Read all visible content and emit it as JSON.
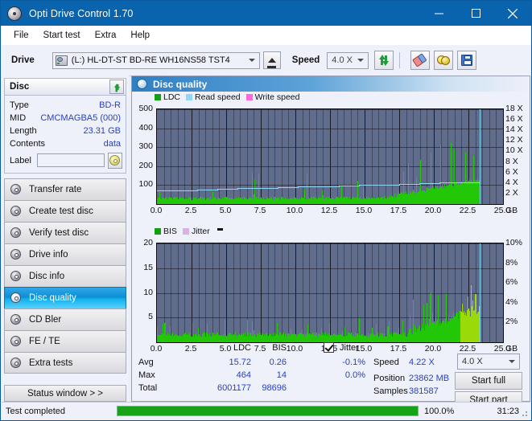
{
  "window": {
    "title": "Opti Drive Control 1.70",
    "app_icon": "disc-icon",
    "minimize": "minimize-icon",
    "maximize": "maximize-icon",
    "close": "close-icon"
  },
  "menu": [
    {
      "label": "File"
    },
    {
      "label": "Start test"
    },
    {
      "label": "Extra"
    },
    {
      "label": "Help"
    }
  ],
  "toolbar": {
    "drive_label": "Drive",
    "drive_value": "(L:)  HL-DT-ST BD-RE  WH16NS58 TST4",
    "eject_icon": "eject-icon",
    "speed_label": "Speed",
    "speed_value": "4.0 X",
    "refresh_icon": "refresh-icon",
    "erase_icon": "eraser-icon",
    "coin_icon": "coins-icon",
    "save_icon": "save-icon"
  },
  "disc_panel": {
    "title": "Disc",
    "refresh_icon": "refresh-icon",
    "rows": [
      {
        "key": "Type",
        "value": "BD-R"
      },
      {
        "key": "MID",
        "value": "CMCMAGBA5 (000)"
      },
      {
        "key": "Length",
        "value": "23.31 GB"
      },
      {
        "key": "Contents",
        "value": "data"
      }
    ],
    "label_key": "Label",
    "label_value": "",
    "label_placeholder": "",
    "label_button_icon": "cd-icon"
  },
  "sidebar": {
    "items": [
      {
        "label": "Transfer rate",
        "icon": "disc-icon",
        "active": false
      },
      {
        "label": "Create test disc",
        "icon": "disc-icon",
        "active": false
      },
      {
        "label": "Verify test disc",
        "icon": "disc-icon",
        "active": false
      },
      {
        "label": "Drive info",
        "icon": "disc-icon",
        "active": false
      },
      {
        "label": "Disc info",
        "icon": "disc-icon",
        "active": false
      },
      {
        "label": "Disc quality",
        "icon": "disc-icon",
        "active": true
      },
      {
        "label": "CD Bler",
        "icon": "disc-icon",
        "active": false
      },
      {
        "label": "FE / TE",
        "icon": "disc-icon",
        "active": false
      },
      {
        "label": "Extra tests",
        "icon": "disc-icon",
        "active": false
      }
    ],
    "status_window": "Status window > >"
  },
  "content": {
    "header_title": "Disc quality",
    "header_icon": "disc-icon"
  },
  "chart_data": [
    {
      "type": "line",
      "name": "ldc-chart",
      "title": "",
      "xlabel": "GB",
      "ylabel": "",
      "x_ticks": [
        "0.0",
        "2.5",
        "5.0",
        "7.5",
        "10.0",
        "12.5",
        "15.0",
        "17.5",
        "20.0",
        "22.5",
        "25.0"
      ],
      "xlim": [
        0.0,
        25.0
      ],
      "y_left_ticks": [
        "100",
        "200",
        "300",
        "400",
        "500"
      ],
      "ylim": [
        0,
        500
      ],
      "y_right_ticks": [
        "2 X",
        "4 X",
        "6 X",
        "8 X",
        "10 X",
        "12 X",
        "14 X",
        "16 X",
        "18 X"
      ],
      "ylim_right": [
        0,
        18
      ],
      "x_unit": "GB",
      "legend": [
        {
          "label": "LDC",
          "color": "#12a012"
        },
        {
          "label": "Read speed",
          "color": "#8fd8f5"
        },
        {
          "label": "Write speed",
          "color": "#ff66dd"
        }
      ],
      "legend_position": "top-left",
      "grid": true,
      "series": [
        {
          "name": "LDC",
          "color": "#22c808",
          "kind": "bar",
          "max_value": 464,
          "avg_value": 15.72
        },
        {
          "name": "Read speed",
          "color": "#8fd8f5",
          "kind": "line",
          "start_x": 0.0,
          "end_x": 23.3,
          "start_value": 2.6,
          "end_value": 4.3
        }
      ],
      "data_end_x": 23.31
    },
    {
      "type": "line",
      "name": "bis-chart",
      "title": "",
      "xlabel": "GB",
      "ylabel": "",
      "x_ticks": [
        "0.0",
        "2.5",
        "5.0",
        "7.5",
        "10.0",
        "12.5",
        "15.0",
        "17.5",
        "20.0",
        "22.5",
        "25.0"
      ],
      "xlim": [
        0.0,
        25.0
      ],
      "y_left_ticks": [
        "5",
        "10",
        "15",
        "20"
      ],
      "ylim": [
        0,
        20
      ],
      "y_right_ticks": [
        "2%",
        "4%",
        "6%",
        "8%",
        "10%"
      ],
      "ylim_right": [
        0,
        10
      ],
      "x_unit": "GB",
      "legend": [
        {
          "label": "BIS",
          "color": "#12a012"
        },
        {
          "label": "Jitter",
          "color": "#d9b3e0"
        }
      ],
      "legend_position": "top-left",
      "grid": true,
      "series": [
        {
          "name": "BIS",
          "color": "#22c808",
          "kind": "bar",
          "max_value": 14,
          "avg_value": 0.26
        }
      ],
      "data_end_x": 23.31
    }
  ],
  "stats": {
    "col_headers": [
      "LDC",
      "BIS"
    ],
    "jitter_label": "Jitter",
    "jitter_checked": true,
    "rows": [
      {
        "label": "Avg",
        "ldc": "15.72",
        "bis": "0.26",
        "jitter": "-0.1%"
      },
      {
        "label": "Max",
        "ldc": "464",
        "bis": "14",
        "jitter": "0.0%"
      },
      {
        "label": "Total",
        "ldc": "6001177",
        "bis": "98696",
        "jitter": ""
      }
    ],
    "speed_label": "Speed",
    "speed_value": "4.22 X",
    "position_label": "Position",
    "position_value": "23862 MB",
    "samples_label": "Samples",
    "samples_value": "381587",
    "speed_select": "4.0 X",
    "start_full": "Start full",
    "start_part": "Start part"
  },
  "statusbar": {
    "message": "Test completed",
    "percent": "100.0%",
    "progress": 100,
    "elapsed": "31:23"
  }
}
